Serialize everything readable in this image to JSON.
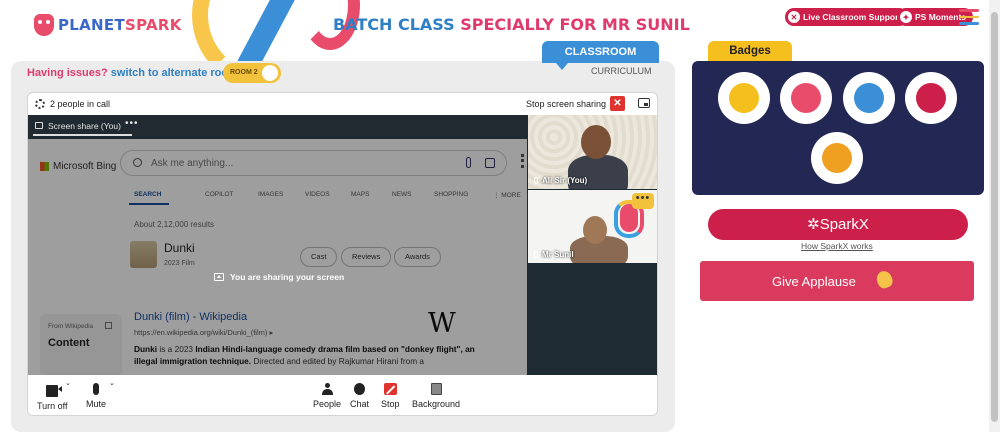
{
  "brand": {
    "logo_part1": "PLANET",
    "logo_part2": "SPARK"
  },
  "header": {
    "title_part1": "BATCH CLASS",
    "title_part2": "SPECIALLY FOR MR SUNIL",
    "live_support": "Live Classroom Support",
    "ps_moments": "PS Moments",
    "menu_colors": [
      "#e94b6b",
      "#f2c23c",
      "#3a8fd6"
    ]
  },
  "tabs": {
    "classroom": "CLASSROOM",
    "curriculum": "CURRICULUM"
  },
  "issues": {
    "prefix": "Having issues?",
    "link": "switch to alternate room",
    "toggle_label": "ROOM 2"
  },
  "call": {
    "people_count": "2 people in call",
    "stop_sharing": "Stop screen sharing",
    "share_tab": "Screen share (You)",
    "share_tab_more": "•••",
    "sharing_notice": "You are sharing your screen",
    "participants": [
      {
        "name": "Ali Sir (You)"
      },
      {
        "name": "Mr Sunil"
      }
    ],
    "tile_menu": "•••",
    "controls": {
      "camera": "Turn off",
      "mic": "Mute",
      "people": "People",
      "chat": "Chat",
      "stop": "Stop",
      "background": "Background"
    }
  },
  "shared_screen": {
    "bing_brand": "Microsoft Bing",
    "search_placeholder": "Ask me anything...",
    "nav": [
      "SEARCH",
      "COPILOT",
      "IMAGES",
      "VIDEOS",
      "MAPS",
      "NEWS",
      "SHOPPING",
      "⋮ MORE"
    ],
    "about": "About 2,12,000 results",
    "entity_title": "Dunki",
    "entity_sub": "2023 Film",
    "chips": [
      "Cast",
      "Reviews",
      "Awards"
    ],
    "from_wiki": "From Wikipedia",
    "content_label": "Content",
    "result_title": "Dunki (film) - Wikipedia",
    "result_url": "https://en.wikipedia.org/wiki/Dunki_(film) ▸",
    "snippet_1": "Dunki",
    "snippet_2": " is a 2023 ",
    "snippet_3": "Indian Hindi-language comedy drama film based on \"donkey flight\", an illegal immigration technique.",
    "snippet_4": " Directed and edited by Rajkumar Hirani from a",
    "wiki_glyph": "W"
  },
  "badges": {
    "title": "Badges",
    "colors": [
      "#f5bf1e",
      "#e94b6b",
      "#3a8fd6",
      "#cc1f4a",
      "#f0a020"
    ]
  },
  "sparkx": {
    "label": "SparkX",
    "link": "How SparkX works"
  },
  "applause": {
    "label": "Give Applause"
  }
}
